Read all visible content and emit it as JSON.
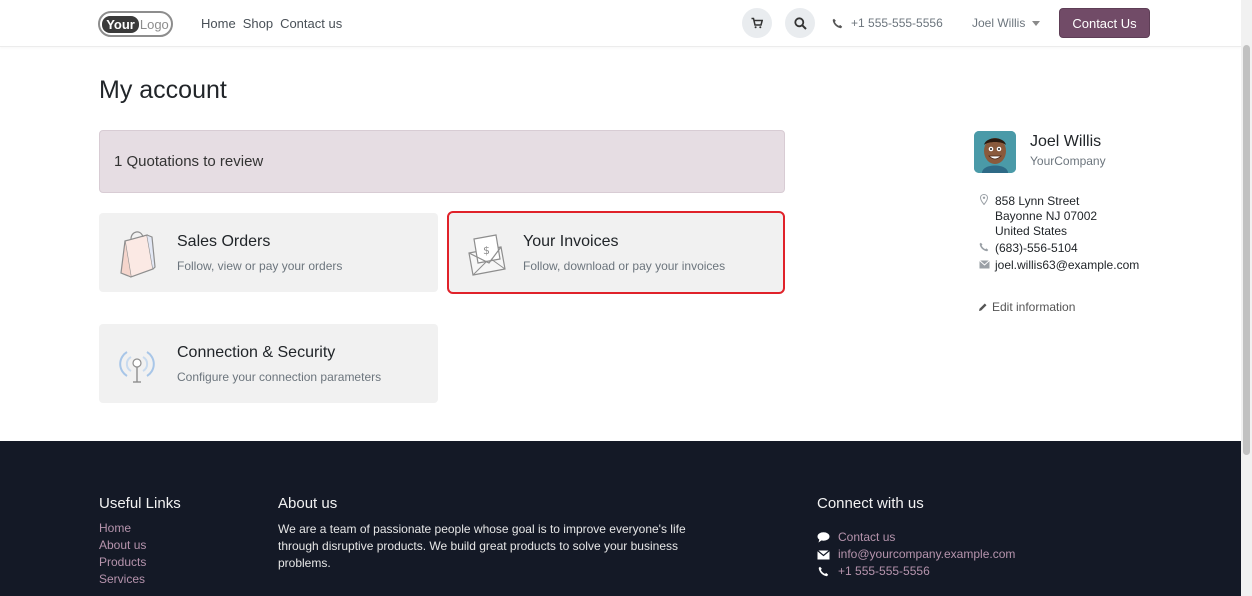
{
  "header": {
    "logo_bold": "Your",
    "logo_light": "Logo",
    "nav": [
      "Home",
      "Shop",
      "Contact us"
    ],
    "phone": "+1 555-555-5556",
    "user": "Joel Willis",
    "contact_button": "Contact Us"
  },
  "main": {
    "title": "My account",
    "alert": "1 Quotations to review",
    "cards": {
      "sales": {
        "title": "Sales Orders",
        "desc": "Follow, view or pay your orders"
      },
      "invoices": {
        "title": "Your Invoices",
        "desc": "Follow, download or pay your invoices"
      },
      "security": {
        "title": "Connection & Security",
        "desc": "Configure your connection parameters"
      }
    }
  },
  "sidebar": {
    "name": "Joel Willis",
    "company": "YourCompany",
    "address": [
      "858 Lynn Street",
      "Bayonne NJ 07002",
      "United States"
    ],
    "phone": "(683)-556-5104",
    "email": "joel.willis63@example.com",
    "edit": "Edit information"
  },
  "footer": {
    "useful_links_title": "Useful Links",
    "useful_links": [
      "Home",
      "About us",
      "Products",
      "Services"
    ],
    "about_title": "About us",
    "about_text": "We are a team of passionate people whose goal is to improve everyone's life through disruptive products. We build great products to solve your business problems.",
    "connect_title": "Connect with us",
    "connect": {
      "contact": "Contact us",
      "email": "info@yourcompany.example.com",
      "phone": "+1 555-555-5556"
    }
  },
  "colors": {
    "primary": "#714b67",
    "alert_bg": "#e6dde3",
    "footer_bg": "#141926",
    "footer_link": "#b694ad",
    "highlight": "#e0222a"
  }
}
